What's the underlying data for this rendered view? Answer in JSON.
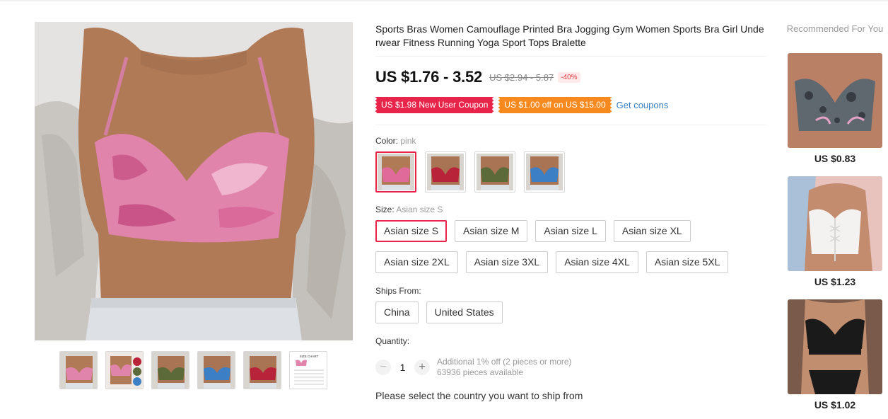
{
  "product": {
    "title": "Sports Bras Women Camouflage Printed Bra Jogging Gym Women Sports Bra Girl Underwear Fitness Running Yoga Sport Tops Bralette",
    "price": "US $1.76 - 3.52",
    "original_price": "US $2.94 - 5.87",
    "discount": "-40%"
  },
  "coupons": {
    "new_user": "US $1.98 New User Coupon",
    "store": "US $1.00 off on US $15.00",
    "get_link": "Get coupons"
  },
  "color": {
    "label": "Color:",
    "selected": "pink",
    "swatches": [
      {
        "name": "pink",
        "hex": "#e06a9a"
      },
      {
        "name": "red",
        "hex": "#b8233a"
      },
      {
        "name": "green",
        "hex": "#5c6a3a"
      },
      {
        "name": "blue",
        "hex": "#3c7fc4"
      }
    ]
  },
  "size": {
    "label": "Size:",
    "selected": "Asian size S",
    "options": [
      "Asian size S",
      "Asian size M",
      "Asian size L",
      "Asian size XL",
      "Asian size 2XL",
      "Asian size 3XL",
      "Asian size 4XL",
      "Asian size 5XL"
    ]
  },
  "ships_from": {
    "label": "Ships From:",
    "options": [
      "China",
      "United States"
    ]
  },
  "quantity": {
    "label": "Quantity:",
    "minus": "−",
    "value": "1",
    "plus": "+",
    "discount_note": "Additional 1% off (2 pieces or more)",
    "available": "63936 pieces available"
  },
  "ship_message": "Please select the country you want to ship from",
  "recommended": {
    "title": "Recommended For You",
    "items": [
      {
        "price": "US $0.83"
      },
      {
        "price": "US $1.23"
      },
      {
        "price": "US $1.02"
      }
    ]
  },
  "thumbnails": {
    "size_chart_label": "SIZE CHART"
  },
  "colors": {
    "accent": "#e8244a",
    "coupon_orange": "#f68a1e",
    "link": "#3a7fc1"
  }
}
